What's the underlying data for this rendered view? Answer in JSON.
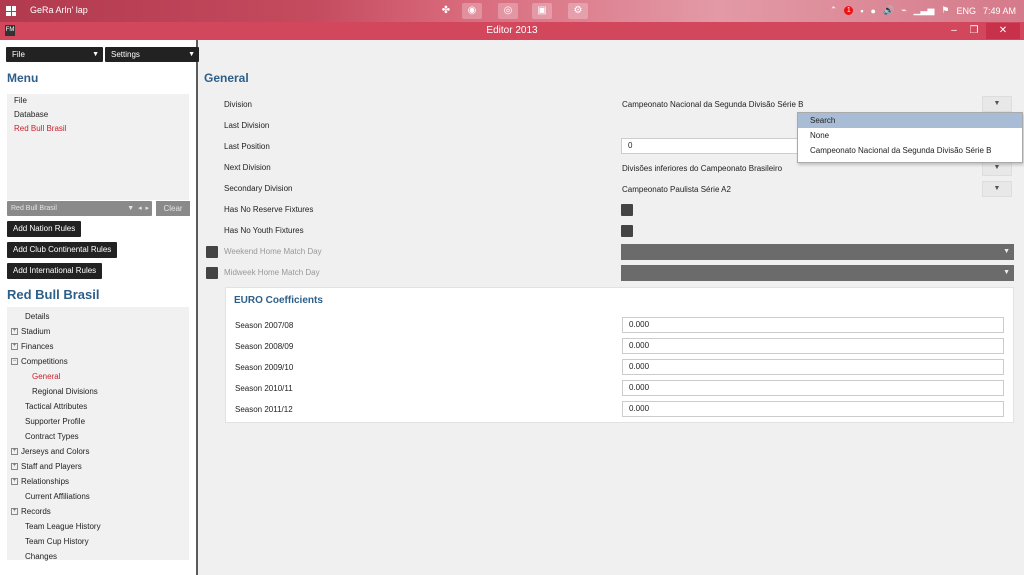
{
  "taskbar": {
    "user": "GeRa Arln' lap",
    "tray": {
      "lang": "ENG",
      "time": "7:49 AM"
    }
  },
  "window": {
    "title": "Editor 2013",
    "min": "–",
    "max": "❐",
    "close": "✕"
  },
  "left": {
    "file_label": "File",
    "settings_label": "Settings",
    "menu_title": "Menu",
    "menu_items": [
      "File",
      "Database",
      "Red Bull Brasil"
    ],
    "club_combo": "Red Bull Brasil",
    "clear_label": "Clear",
    "buttons": [
      "Add Nation Rules",
      "Add Club Continental Rules",
      "Add International Rules"
    ],
    "club_title": "Red Bull Brasil",
    "tree": [
      {
        "label": "Details",
        "pm": ""
      },
      {
        "label": "Stadium",
        "pm": "+"
      },
      {
        "label": "Finances",
        "pm": "+"
      },
      {
        "label": "Competitions",
        "pm": "−"
      },
      {
        "label": "General",
        "pm": ""
      },
      {
        "label": "Regional Divisions",
        "pm": ""
      },
      {
        "label": "Tactical Attributes",
        "pm": ""
      },
      {
        "label": "Supporter Profile",
        "pm": ""
      },
      {
        "label": "Contract Types",
        "pm": ""
      },
      {
        "label": "Jerseys and Colors",
        "pm": "+"
      },
      {
        "label": "Staff and Players",
        "pm": "+"
      },
      {
        "label": "Relationships",
        "pm": "+"
      },
      {
        "label": "Current Affiliations",
        "pm": ""
      },
      {
        "label": "Records",
        "pm": "+"
      },
      {
        "label": "Team League History",
        "pm": ""
      },
      {
        "label": "Team Cup History",
        "pm": ""
      },
      {
        "label": "Changes",
        "pm": ""
      }
    ]
  },
  "main": {
    "title": "General",
    "division_label": "Division",
    "division_value": "Campeonato Nacional da Segunda Divisão Série B",
    "last_division_label": "Last Division",
    "last_position_label": "Last Position",
    "last_position_value": "0",
    "next_division_label": "Next Division",
    "next_division_value": "Divisões inferiores do Campeonato Brasileiro",
    "secondary_division_label": "Secondary Division",
    "secondary_division_value": "Campeonato Paulista Série A2",
    "no_reserve_label": "Has No Reserve Fixtures",
    "no_youth_label": "Has No Youth Fixtures",
    "weekend_label": "Weekend Home Match Day",
    "midweek_label": "Midweek Home Match Day",
    "euro": {
      "title": "EURO Coefficients",
      "seasons": [
        {
          "label": "Season 2007/08",
          "value": "0.000"
        },
        {
          "label": "Season 2008/09",
          "value": "0.000"
        },
        {
          "label": "Season 2009/10",
          "value": "0.000"
        },
        {
          "label": "Season 2010/11",
          "value": "0.000"
        },
        {
          "label": "Season 2011/12",
          "value": "0.000"
        }
      ]
    }
  },
  "dropdown": [
    "Search",
    "None",
    "Campeonato Nacional da Segunda Divisão Série B"
  ]
}
